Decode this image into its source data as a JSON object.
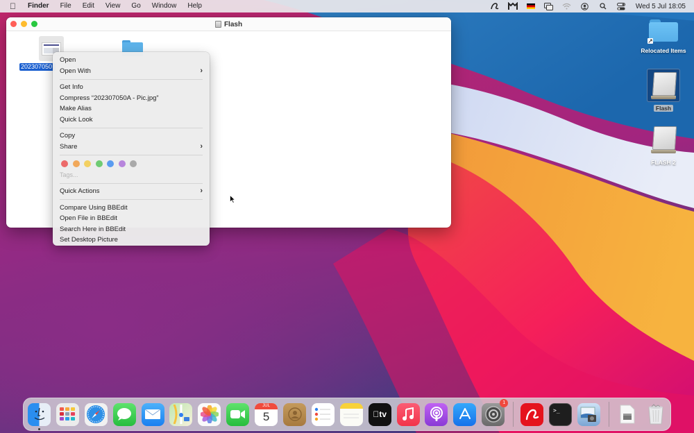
{
  "menubar": {
    "apple_icon": "apple-logo",
    "app_name": "Finder",
    "menus": [
      "File",
      "Edit",
      "View",
      "Go",
      "Window",
      "Help"
    ],
    "status_icons": [
      "avira-icon",
      "mail-monitor-icon",
      "german-flag-icon",
      "screen-mirror-icon",
      "wifi-icon",
      "user-icon",
      "search-icon",
      "control-center-icon"
    ],
    "clock": "Wed 5 Jul  18:05"
  },
  "finder_window": {
    "title": "Flash",
    "title_icon": "drive-icon",
    "items": [
      {
        "name": "202307050A - Pic.jpg",
        "label_truncated": "202307050",
        "type": "image-file",
        "selected": true
      },
      {
        "name": "",
        "type": "folder",
        "selected": false
      }
    ]
  },
  "context_menu": {
    "groups": [
      [
        {
          "label": "Open",
          "submenu": false
        },
        {
          "label": "Open With",
          "submenu": true
        }
      ],
      [
        {
          "label": "Get Info",
          "submenu": false
        },
        {
          "label": "Compress “202307050A - Pic.jpg”",
          "submenu": false
        },
        {
          "label": "Make Alias",
          "submenu": false
        },
        {
          "label": "Quick Look",
          "submenu": false
        }
      ],
      [
        {
          "label": "Copy",
          "submenu": false
        },
        {
          "label": "Share",
          "submenu": true
        }
      ]
    ],
    "tag_colors": [
      {
        "name": "red",
        "color": "#ec6a6a"
      },
      {
        "name": "orange",
        "color": "#f1a85a"
      },
      {
        "name": "yellow",
        "color": "#f3d061"
      },
      {
        "name": "green",
        "color": "#6fcb73"
      },
      {
        "name": "blue",
        "color": "#5a9cf0"
      },
      {
        "name": "purple",
        "color": "#b785dc"
      },
      {
        "name": "gray",
        "color": "#a9a9a9"
      }
    ],
    "tags_placeholder": "Tags...",
    "quick_actions": {
      "label": "Quick Actions",
      "submenu": true
    },
    "bbedit_group": [
      {
        "label": "Compare Using BBEdit"
      },
      {
        "label": "Open File in BBEdit"
      },
      {
        "label": "Search Here in BBEdit"
      },
      {
        "label": "Set Desktop Picture"
      }
    ],
    "chevron": "›"
  },
  "desktop": {
    "items": [
      {
        "label": "Relocated Items",
        "type": "folder-alias"
      },
      {
        "label": "Flash",
        "type": "drive",
        "selected": true
      },
      {
        "label": "FLASH 2",
        "type": "drive",
        "selected": false
      }
    ]
  },
  "dock": {
    "apps": [
      {
        "name": "Finder",
        "running": true
      },
      {
        "name": "Launchpad"
      },
      {
        "name": "Safari"
      },
      {
        "name": "Messages"
      },
      {
        "name": "Mail"
      },
      {
        "name": "Maps"
      },
      {
        "name": "Photos"
      },
      {
        "name": "FaceTime"
      },
      {
        "name": "Calendar",
        "month": "JUL",
        "day": "5"
      },
      {
        "name": "Contacts"
      },
      {
        "name": "Reminders"
      },
      {
        "name": "Notes"
      },
      {
        "name": "TV",
        "text": "tv"
      },
      {
        "name": "Music"
      },
      {
        "name": "Podcasts"
      },
      {
        "name": "App Store"
      },
      {
        "name": "System Preferences",
        "badge": "1"
      }
    ],
    "recent_apps": [
      {
        "name": "Avira"
      },
      {
        "name": "Terminal",
        "text": ">_"
      },
      {
        "name": "Preview"
      }
    ],
    "other": [
      {
        "name": "Disk Image Document"
      },
      {
        "name": "Trash"
      }
    ]
  }
}
